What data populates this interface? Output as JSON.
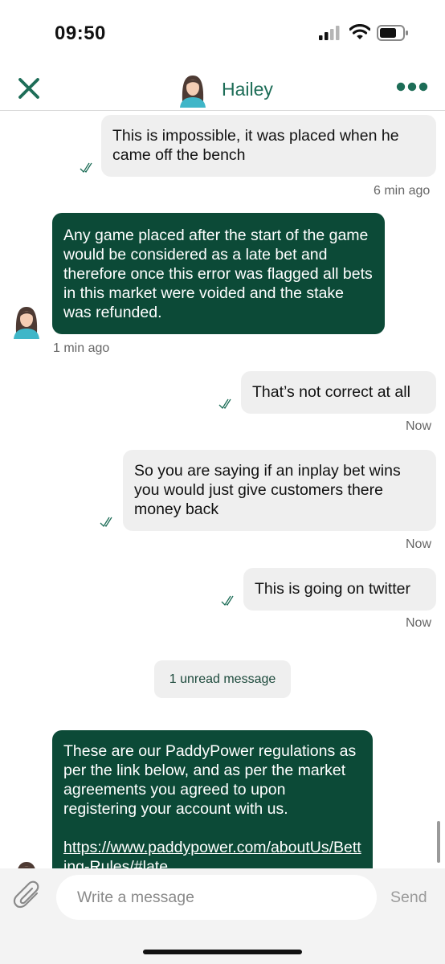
{
  "status": {
    "time": "09:50"
  },
  "header": {
    "agent_name": "Hailey"
  },
  "messages": [
    {
      "text": "This is impossible, it was placed when he came off the bench",
      "timestamp": "6 min ago"
    },
    {
      "text": "Any game placed after the start of the game would be considered as a late bet and therefore once this error was flagged all bets in this market were voided and the stake was refunded.",
      "timestamp": "1 min ago"
    },
    {
      "text": "That’s not correct at all",
      "timestamp": "Now"
    },
    {
      "text": "So you are saying if an inplay bet wins you would just give customers there money back",
      "timestamp": "Now"
    },
    {
      "text": "This is going on twitter",
      "timestamp": "Now"
    },
    {
      "text": "These are our PaddyPower regulations as per the link below, and as per the market agreements you agreed to upon registering your account with us.",
      "link": "https://www.paddypower.com/aboutUs/Betting-Rules/#late"
    }
  ],
  "unread_label": "1 unread message",
  "composer": {
    "placeholder": "Write a message",
    "send_label": "Send"
  },
  "colors": {
    "accent": "#1d6d57",
    "agent_bubble": "#0c4a37",
    "user_bubble": "#efefef"
  },
  "icons": [
    "close-icon",
    "more-icon",
    "double-check-icon",
    "paperclip-icon",
    "signal-icon",
    "wifi-icon",
    "battery-icon"
  ]
}
